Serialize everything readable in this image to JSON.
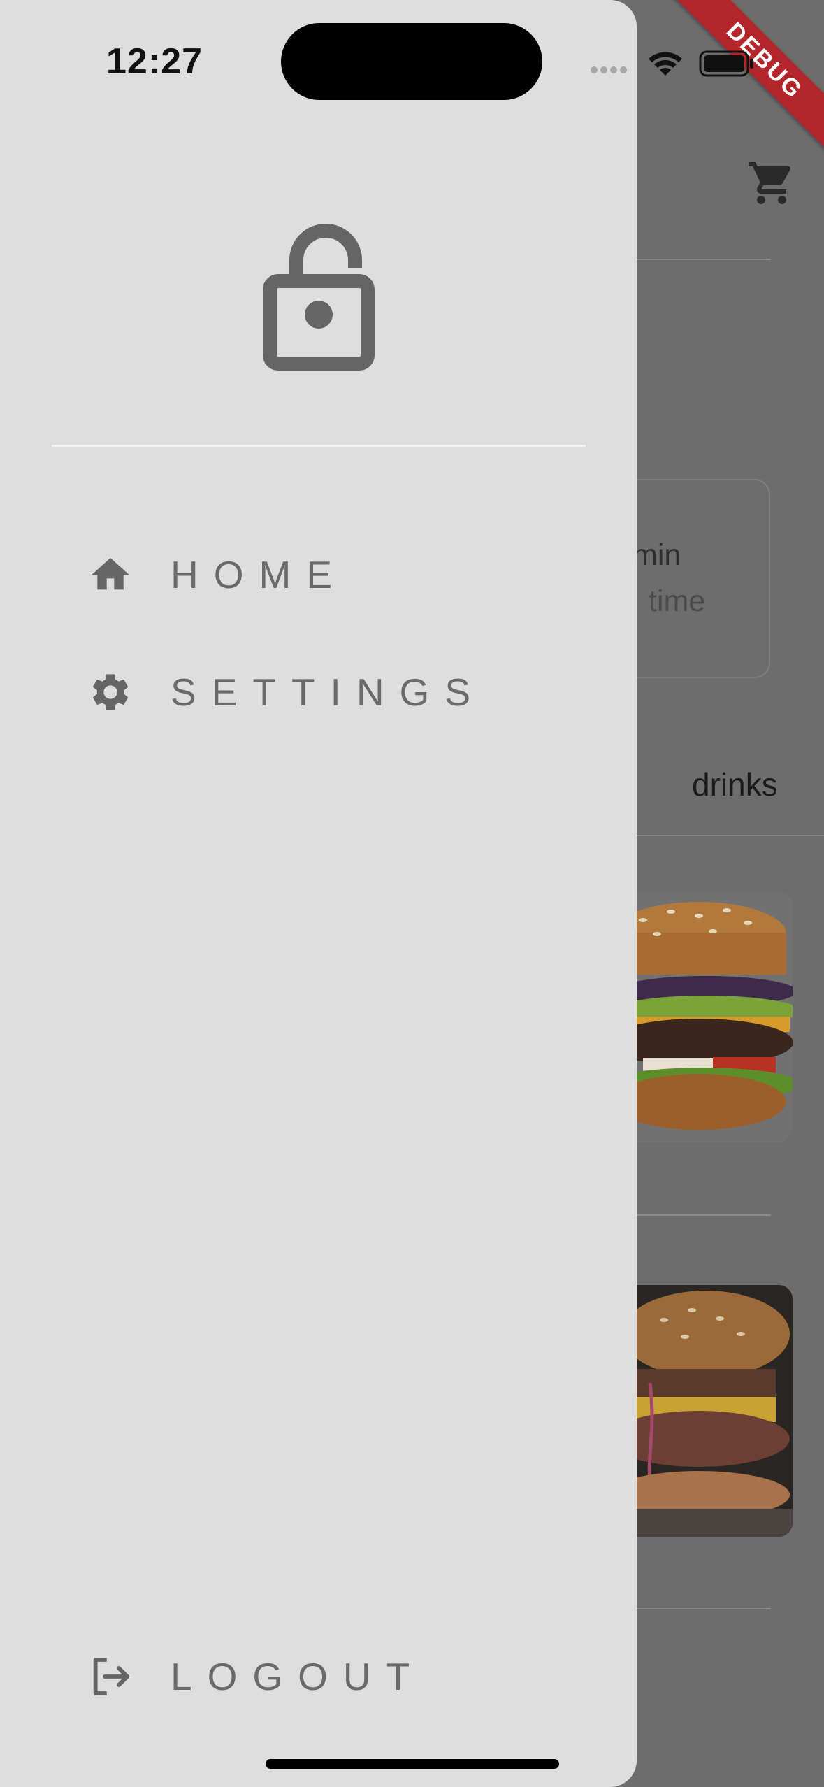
{
  "status_bar": {
    "time": "12:27"
  },
  "debug_banner": "DEBUG",
  "drawer": {
    "menu": [
      {
        "label": "HOME",
        "icon": "home-icon"
      },
      {
        "label": "SETTINGS",
        "icon": "gear-icon"
      }
    ],
    "logout": {
      "label": "LOGOUT",
      "icon": "logout-icon"
    },
    "header_icon": "lock-open-icon"
  },
  "background": {
    "info_card": {
      "value_suffix": "min",
      "caption": "time"
    },
    "category_tab": "drinks",
    "cart_icon": "cart-icon"
  },
  "colors": {
    "drawer_bg": "#dedede",
    "icon_gray": "#656565",
    "scrim": "#6d6d6d",
    "debug_red": "#b3262b"
  }
}
